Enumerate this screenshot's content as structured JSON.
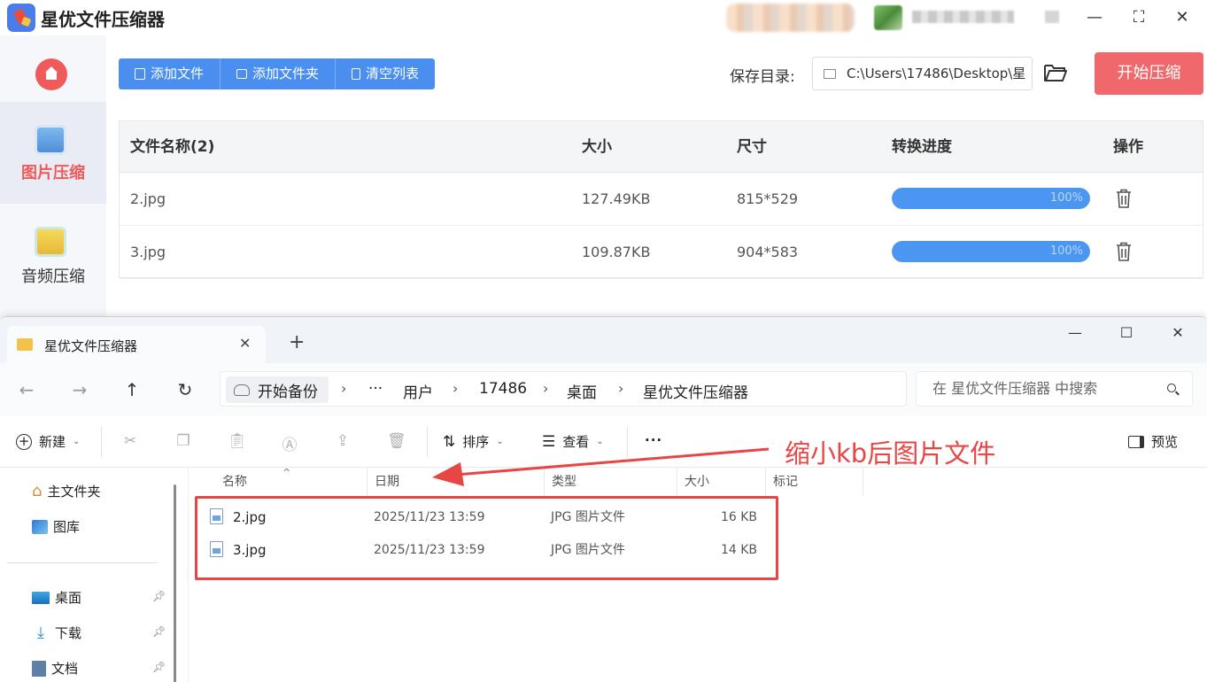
{
  "app": {
    "title": "星优文件压缩器",
    "window_controls": {
      "minimize": "—",
      "maximize": "⛶",
      "close": "✕"
    },
    "sidebar": [
      {
        "label": "图片压缩",
        "active": true
      },
      {
        "label": "音频压缩",
        "active": false
      }
    ],
    "toolbar": {
      "add_file": "添加文件",
      "add_folder": "添加文件夹",
      "clear_list": "清空列表"
    },
    "save_dir": {
      "label": "保存目录:",
      "value": "C:\\Users\\17486\\Desktop\\星"
    },
    "start_button": "开始压缩",
    "table": {
      "headers": {
        "name": "文件名称(2)",
        "size": "大小",
        "dimensions": "尺寸",
        "progress": "转换进度",
        "action": "操作"
      },
      "rows": [
        {
          "name": "2.jpg",
          "size": "127.49KB",
          "dimensions": "815*529",
          "progress": 1.0,
          "progress_text": "100%"
        },
        {
          "name": "3.jpg",
          "size": "109.87KB",
          "dimensions": "904*583",
          "progress": 1.0,
          "progress_text": "100%"
        }
      ]
    },
    "colors": {
      "accent_blue": "#4a8ff0",
      "start_red": "#f0686b",
      "active_red": "#ef5a5a"
    }
  },
  "explorer": {
    "tab_title": "星优文件压缩器",
    "breadcrumb": {
      "home": "开始备份",
      "more": "···",
      "items": [
        "用户",
        "17486",
        "桌面",
        "星优文件压缩器"
      ]
    },
    "search_placeholder": "在 星优文件压缩器 中搜索",
    "commands": {
      "new": "新建",
      "sort": "排序",
      "view": "查看",
      "more": "···",
      "preview": "预览"
    },
    "nav": [
      {
        "label": "主文件夹",
        "pinned": false
      },
      {
        "label": "图库",
        "pinned": false
      },
      {
        "label": "桌面",
        "pinned": true
      },
      {
        "label": "下载",
        "pinned": true
      },
      {
        "label": "文档",
        "pinned": true
      }
    ],
    "columns": {
      "name": "名称",
      "date": "日期",
      "type": "类型",
      "size": "大小",
      "tags": "标记"
    },
    "files": [
      {
        "name": "2.jpg",
        "date": "2025/11/23 13:59",
        "type": "JPG 图片文件",
        "size": "16 KB"
      },
      {
        "name": "3.jpg",
        "date": "2025/11/23 13:59",
        "type": "JPG 图片文件",
        "size": "14 KB"
      }
    ]
  },
  "annotation": {
    "text": "缩小kb后图片文件",
    "color": "#e84545"
  }
}
